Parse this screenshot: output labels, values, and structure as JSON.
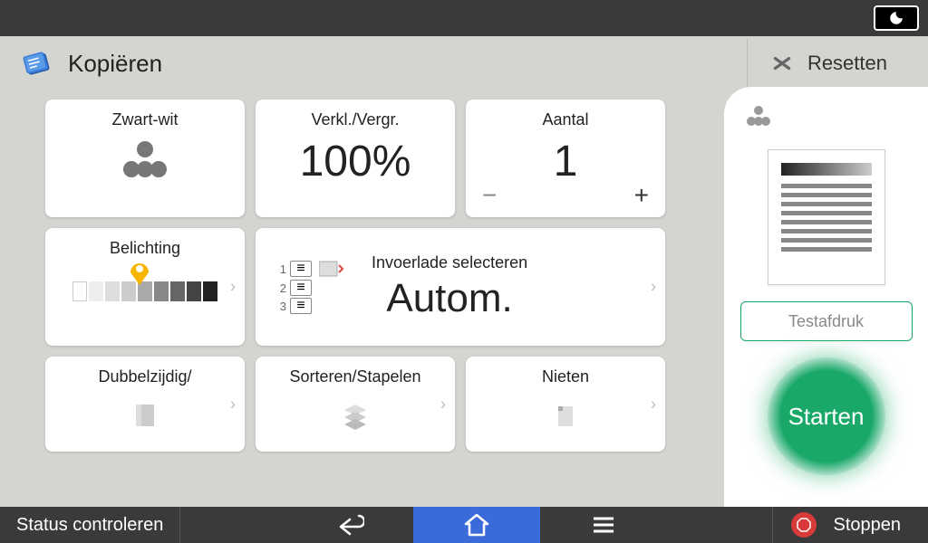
{
  "header": {
    "title": "Kopiëren",
    "reset": "Resetten"
  },
  "tiles": {
    "bw": {
      "label": "Zwart-wit"
    },
    "zoom": {
      "label": "Verkl./Vergr.",
      "value": "100%"
    },
    "qty": {
      "label": "Aantal",
      "value": "1"
    },
    "density": {
      "label": "Belichting"
    },
    "tray": {
      "label": "Invoerlade selecteren",
      "value": "Autom."
    },
    "duplex": {
      "label": "Dubbelzijdig/"
    },
    "sort": {
      "label": "Sorteren/Stapelen"
    },
    "staple": {
      "label": "Nieten"
    }
  },
  "side": {
    "test": "Testafdruk",
    "start": "Starten"
  },
  "bottom": {
    "status": "Status controleren",
    "stop": "Stoppen"
  }
}
